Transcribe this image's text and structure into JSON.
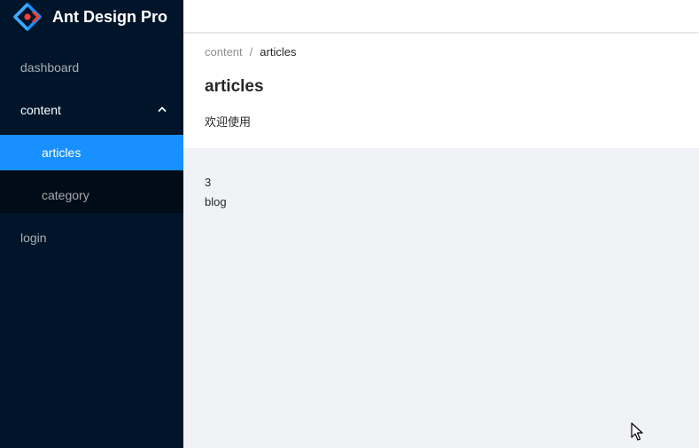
{
  "brand": {
    "title": "Ant Design Pro",
    "logo": "ant-design-logo-icon"
  },
  "colors": {
    "sider": "#001529",
    "submenu": "#000c17",
    "accent": "#1890ff",
    "content_bg": "#f0f2f5"
  },
  "menu": {
    "dashboard": "dashboard",
    "content": "content",
    "articles": "articles",
    "category": "category",
    "login": "login"
  },
  "breadcrumb": {
    "parent": "content",
    "separator": "/",
    "current": "articles"
  },
  "page": {
    "title": "articles",
    "description": "欢迎使用"
  },
  "content": {
    "lines": [
      "3",
      "blog"
    ]
  }
}
